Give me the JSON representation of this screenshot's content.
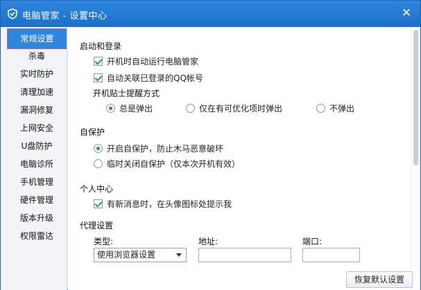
{
  "window": {
    "title": "电脑管家 - 设置中心"
  },
  "sidebar": {
    "items": [
      {
        "label": "常规设置",
        "active": true
      },
      {
        "label": "杀毒"
      },
      {
        "label": "实时防护"
      },
      {
        "label": "清理加速"
      },
      {
        "label": "漏洞修复"
      },
      {
        "label": "上网安全"
      },
      {
        "label": "U盘防护"
      },
      {
        "label": "电脑诊所"
      },
      {
        "label": "手机管理"
      },
      {
        "label": "硬件管理"
      },
      {
        "label": "版本升级"
      },
      {
        "label": "权限雷达"
      }
    ]
  },
  "startup": {
    "heading": "启动和登录",
    "autorun": "开机时自动运行电脑管家",
    "link_qq": "自动关联已登录的QQ帐号",
    "tip_mode_label": "开机贴士提醒方式",
    "tip_options": [
      "总是弹出",
      "仅在有可优化项时弹出",
      "不弹出"
    ],
    "tip_selected": "总是弹出"
  },
  "selfprotect": {
    "heading": "自保护",
    "on": "开启自保护，防止木马恶意破坏",
    "off": "临时关闭自保护（仅本次开机有效）",
    "selected": "on"
  },
  "personal": {
    "heading": "个人中心",
    "notify": "有新消息时，在头像图标处提示我"
  },
  "proxy": {
    "heading": "代理设置",
    "type_label": "类型:",
    "address_label": "地址:",
    "port_label": "端口:",
    "type_value": "使用浏览器设置",
    "address_value": "",
    "port_value": ""
  },
  "footer": {
    "restore_label": "恢复默认设置"
  },
  "colors": {
    "accent": "#2e86de",
    "titlebar": "#1c6fca",
    "check": "#2a9d3a"
  }
}
